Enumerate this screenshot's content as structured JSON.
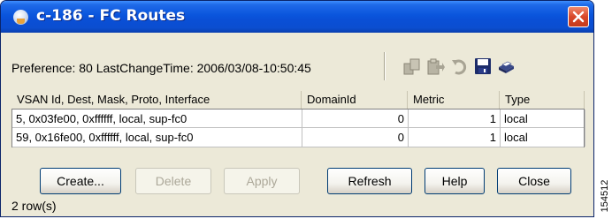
{
  "window": {
    "title": "c-186 - FC Routes"
  },
  "info": {
    "preference_text": "Preference: 80 LastChangeTime: 2006/03/08-10:50:45"
  },
  "toolbar": {
    "icons": [
      "copy-rows-icon",
      "paste-rows-icon",
      "undo-icon",
      "save-icon",
      "print-icon"
    ]
  },
  "table": {
    "columns": [
      "VSAN Id, Dest, Mask, Proto, Interface",
      "DomainId",
      "Metric",
      "Type"
    ],
    "rows": [
      {
        "route": "5, 0x03fe00, 0xffffff, local, sup-fc0",
        "domain_id": "0",
        "metric": "1",
        "type": "local"
      },
      {
        "route": "59, 0x16fe00, 0xffffff, local, sup-fc0",
        "domain_id": "0",
        "metric": "1",
        "type": "local"
      }
    ]
  },
  "buttons": {
    "create": "Create...",
    "delete": "Delete",
    "apply": "Apply",
    "refresh": "Refresh",
    "help": "Help",
    "close": "Close"
  },
  "status": {
    "row_count": "2 row(s)"
  },
  "figure_id": "154512",
  "colors": {
    "title_bar": "#0a55dc",
    "window_bg": "#ece9d8",
    "close_button": "#d8482a"
  }
}
